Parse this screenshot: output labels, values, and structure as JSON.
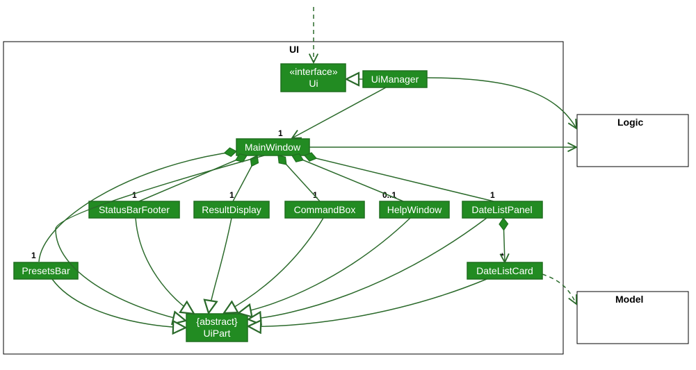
{
  "packages": {
    "ui": {
      "label": "UI"
    },
    "logic": {
      "label": "Logic"
    },
    "model": {
      "label": "Model"
    }
  },
  "classes": {
    "ui_interface": {
      "stereotype": "«interface»",
      "name": "Ui"
    },
    "ui_manager": {
      "name": "UiManager"
    },
    "main_window": {
      "name": "MainWindow"
    },
    "status_bar": {
      "name": "StatusBarFooter"
    },
    "result_display": {
      "name": "ResultDisplay"
    },
    "command_box": {
      "name": "CommandBox"
    },
    "help_window": {
      "name": "HelpWindow"
    },
    "date_list_panel": {
      "name": "DateListPanel"
    },
    "date_list_card": {
      "name": "DateListCard"
    },
    "presets_bar": {
      "name": "PresetsBar"
    },
    "ui_part": {
      "stereotype": "{abstract}",
      "name": "UiPart"
    }
  },
  "multiplicities": {
    "main_window": "1",
    "status_bar": "1",
    "result_display": "1",
    "command_box": "1",
    "help_window": "0..1",
    "date_list_panel": "1",
    "presets_bar": "1",
    "date_list_card": "*"
  },
  "chart_data": {
    "type": "uml_class_diagram",
    "packages": [
      "UI",
      "Logic",
      "Model"
    ],
    "nodes": [
      {
        "id": "Ui",
        "package": "UI",
        "stereotype": "interface"
      },
      {
        "id": "UiManager",
        "package": "UI"
      },
      {
        "id": "MainWindow",
        "package": "UI"
      },
      {
        "id": "StatusBarFooter",
        "package": "UI"
      },
      {
        "id": "ResultDisplay",
        "package": "UI"
      },
      {
        "id": "CommandBox",
        "package": "UI"
      },
      {
        "id": "HelpWindow",
        "package": "UI"
      },
      {
        "id": "DateListPanel",
        "package": "UI"
      },
      {
        "id": "DateListCard",
        "package": "UI"
      },
      {
        "id": "PresetsBar",
        "package": "UI"
      },
      {
        "id": "UiPart",
        "package": "UI",
        "stereotype": "abstract"
      },
      {
        "id": "Logic",
        "package": "Logic"
      },
      {
        "id": "Model",
        "package": "Model"
      }
    ],
    "edges": [
      {
        "from": "(external)",
        "to": "Ui",
        "kind": "dependency"
      },
      {
        "from": "UiManager",
        "to": "Ui",
        "kind": "realization"
      },
      {
        "from": "UiManager",
        "to": "MainWindow",
        "kind": "association",
        "target_mult": "1"
      },
      {
        "from": "MainWindow",
        "to": "StatusBarFooter",
        "kind": "composition",
        "target_mult": "1"
      },
      {
        "from": "MainWindow",
        "to": "ResultDisplay",
        "kind": "composition",
        "target_mult": "1"
      },
      {
        "from": "MainWindow",
        "to": "CommandBox",
        "kind": "composition",
        "target_mult": "1"
      },
      {
        "from": "MainWindow",
        "to": "HelpWindow",
        "kind": "composition",
        "target_mult": "0..1"
      },
      {
        "from": "MainWindow",
        "to": "DateListPanel",
        "kind": "composition",
        "target_mult": "1"
      },
      {
        "from": "MainWindow",
        "to": "PresetsBar",
        "kind": "composition",
        "target_mult": "1"
      },
      {
        "from": "DateListPanel",
        "to": "DateListCard",
        "kind": "composition",
        "target_mult": "*"
      },
      {
        "from": "MainWindow",
        "to": "UiPart",
        "kind": "generalization"
      },
      {
        "from": "StatusBarFooter",
        "to": "UiPart",
        "kind": "generalization"
      },
      {
        "from": "ResultDisplay",
        "to": "UiPart",
        "kind": "generalization"
      },
      {
        "from": "CommandBox",
        "to": "UiPart",
        "kind": "generalization"
      },
      {
        "from": "HelpWindow",
        "to": "UiPart",
        "kind": "generalization"
      },
      {
        "from": "DateListPanel",
        "to": "UiPart",
        "kind": "generalization"
      },
      {
        "from": "DateListCard",
        "to": "UiPart",
        "kind": "generalization"
      },
      {
        "from": "PresetsBar",
        "to": "UiPart",
        "kind": "generalization"
      },
      {
        "from": "UiManager",
        "to": "Logic",
        "kind": "association"
      },
      {
        "from": "MainWindow",
        "to": "Logic",
        "kind": "association"
      },
      {
        "from": "DateListCard",
        "to": "Model",
        "kind": "dependency"
      }
    ]
  }
}
